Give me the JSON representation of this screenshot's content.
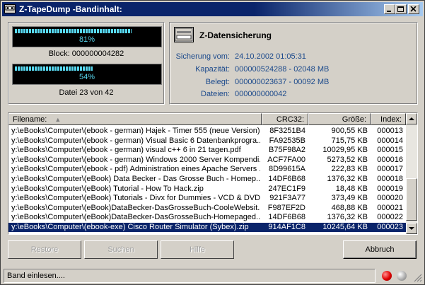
{
  "window": {
    "title": "Z-TapeDump -Bandinhalt:"
  },
  "progress": {
    "block_percent": 81,
    "block_percent_label": "81%",
    "block_label": "Block: 000000004282",
    "file_percent": 54,
    "file_percent_label": "54%",
    "file_label": "Datei 23 von 42"
  },
  "backup": {
    "title": "Z-Datensicherung",
    "fields": [
      {
        "label": "Sicherung vom:",
        "value": "24.10.2002 01:05:31"
      },
      {
        "label": "Kapazität:",
        "value": "000000524288 - 02048 MB"
      },
      {
        "label": "Belegt:",
        "value": "000000023637 - 00092 MB"
      },
      {
        "label": "Dateien:",
        "value": "000000000042"
      }
    ]
  },
  "table": {
    "columns": {
      "filename": "Filename:",
      "crc": "CRC32:",
      "size": "Größe:",
      "index": "Index:"
    },
    "rows": [
      {
        "filename": "y:\\eBooks\\Computer\\(ebook - german) Hajek - Timer 555 (neue Version)...",
        "crc": "8F3251B4",
        "size": "900,55 KB",
        "index": "000013",
        "selected": false
      },
      {
        "filename": "y:\\eBooks\\Computer\\(ebook - german) Visual Basic 6 Datenbankprogra...",
        "crc": "FA92535B",
        "size": "715,75 KB",
        "index": "000014",
        "selected": false
      },
      {
        "filename": "y:\\eBooks\\Computer\\(ebook - german) visual c++ 6 in 21 tagen.pdf",
        "crc": "B75F98A2",
        "size": "10029,95 KB",
        "index": "000015",
        "selected": false
      },
      {
        "filename": "y:\\eBooks\\Computer\\(ebook - german) Windows 2000 Server Kompendi...",
        "crc": "ACF7FA00",
        "size": "5273,52 KB",
        "index": "000016",
        "selected": false
      },
      {
        "filename": "y:\\eBooks\\Computer\\(ebook - pdf) Administration eines Apache Servers ...",
        "crc": "8D99615A",
        "size": "222,83 KB",
        "index": "000017",
        "selected": false
      },
      {
        "filename": "y:\\eBooks\\Computer\\(eBook) Data Becker - Das Grosse Buch - Homep...",
        "crc": "14DF6B68",
        "size": "1376,32 KB",
        "index": "000018",
        "selected": false
      },
      {
        "filename": "y:\\eBooks\\Computer\\(eBook) Tutorial - How To Hack.zip",
        "crc": "247EC1F9",
        "size": "18,48 KB",
        "index": "000019",
        "selected": false
      },
      {
        "filename": "y:\\eBooks\\Computer\\(eBook) Tutorials - Divx for Dummies - VCD & DVD ...",
        "crc": "921F3A77",
        "size": "373,49 KB",
        "index": "000020",
        "selected": false
      },
      {
        "filename": "y:\\eBooks\\Computer\\(eBook)DataBecker-DasGrosseBuch-CooleWebsit...",
        "crc": "F987EF2D",
        "size": "468,88 KB",
        "index": "000021",
        "selected": false
      },
      {
        "filename": "y:\\eBooks\\Computer\\(eBook)DataBecker-DasGrosseBuch-Homepaged...",
        "crc": "14DF6B68",
        "size": "1376,32 KB",
        "index": "000022",
        "selected": false
      },
      {
        "filename": "y:\\eBooks\\Computer\\(ebook-exe) Cisco Router Simulator (Sybex).zip",
        "crc": "914AF1C8",
        "size": "10245,64 KB",
        "index": "000023",
        "selected": true
      }
    ]
  },
  "buttons": {
    "restore": "Restore",
    "search": "Suchen",
    "help": "Hilfe",
    "cancel": "Abbruch"
  },
  "status": {
    "text": "Band einlesen...."
  },
  "colors": {
    "titlebar": "#0a246a",
    "progress": "#58d8f0",
    "led_red": "#e00000",
    "led_gray": "#b0b0b0"
  }
}
